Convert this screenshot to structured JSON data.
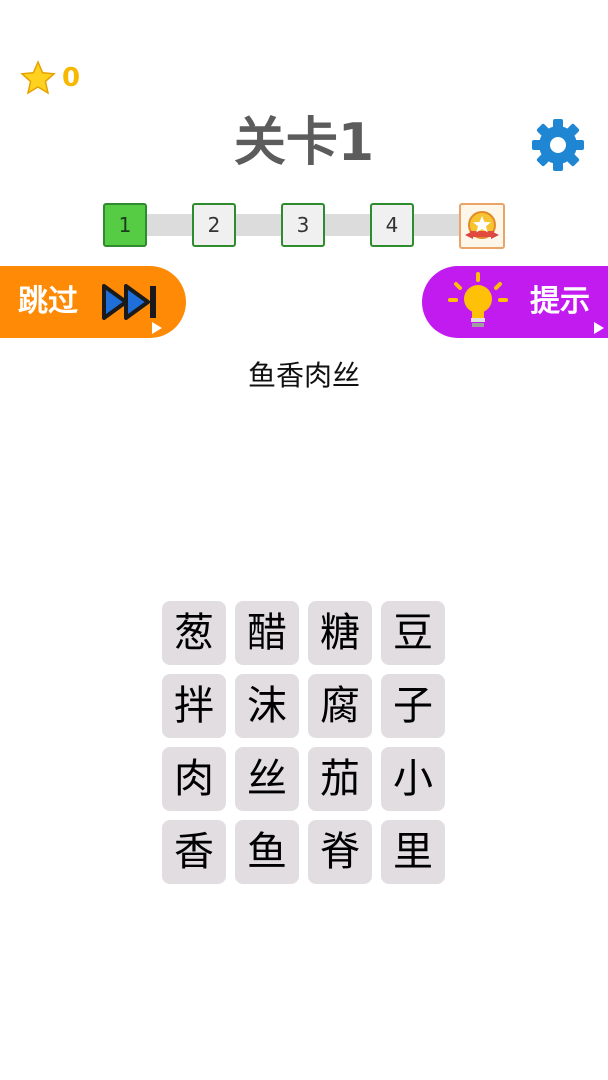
{
  "header": {
    "score": "0",
    "level_title": "关卡1",
    "settings_icon": "gear-icon"
  },
  "progress": {
    "stages": [
      "1",
      "2",
      "3",
      "4"
    ],
    "current_stage": 1,
    "reward_icon": "medal-star-icon",
    "colors": {
      "active": "#55cc44",
      "border": "#2e8b2e",
      "track": "#dcdcdc"
    }
  },
  "buttons": {
    "skip_label": "跳过",
    "skip_icon": "fast-forward-icon",
    "skip_color": "#ff8a06",
    "hint_label": "提示",
    "hint_icon": "lightbulb-icon",
    "hint_color": "#c21bf0"
  },
  "puzzle": {
    "target": "鱼香肉丝",
    "tiles": [
      "葱",
      "醋",
      "糖",
      "豆",
      "拌",
      "沫",
      "腐",
      "子",
      "肉",
      "丝",
      "茄",
      "小",
      "香",
      "鱼",
      "脊",
      "里"
    ]
  }
}
